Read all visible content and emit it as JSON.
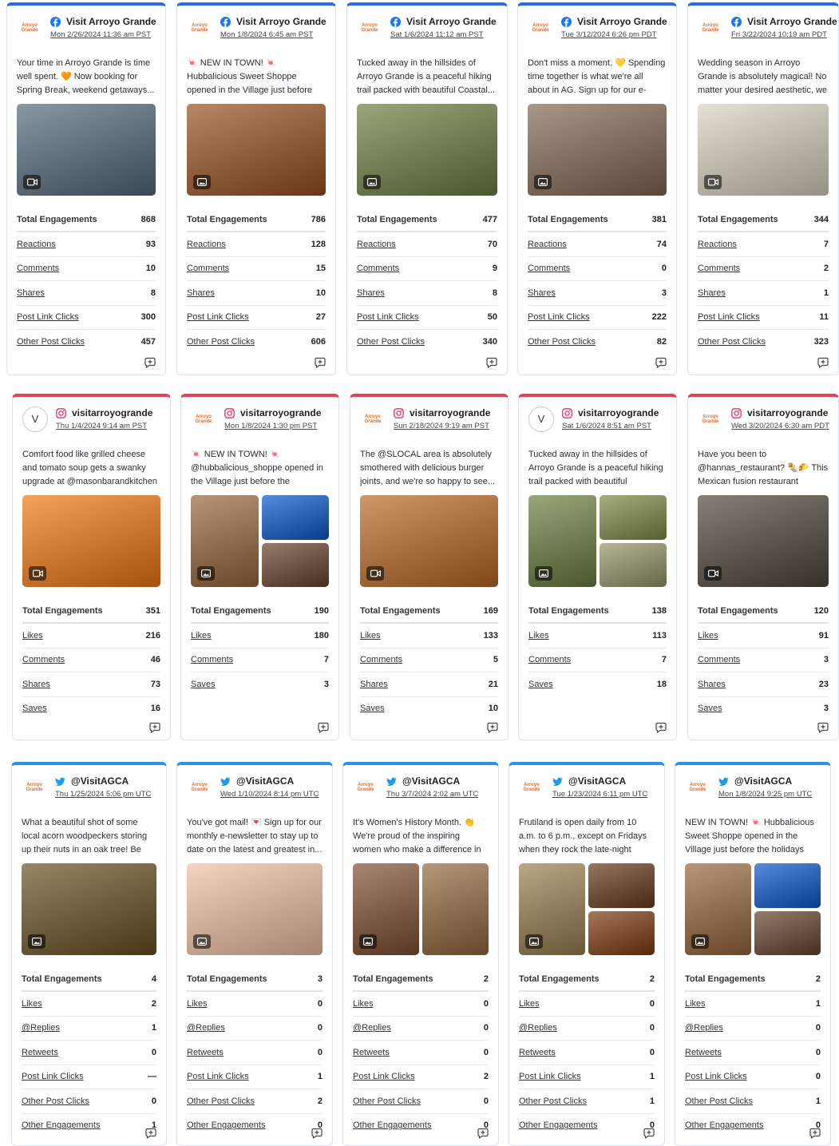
{
  "cards": [
    {
      "id": "c1",
      "network": "facebook",
      "account": "Visit Arroyo Grande",
      "avatar": "logo",
      "date": "Mon 2/26/2024 11:36 am PST",
      "text": "Your time in Arroyo Grande is time well spent. 🧡 Now booking for Spring Break, weekend getaways...",
      "media": "video",
      "layout": "single",
      "colors": [
        "#5c6b78"
      ],
      "metrics": [
        [
          "Total Engagements",
          "868"
        ],
        [
          "Reactions",
          "93"
        ],
        [
          "Comments",
          "10"
        ],
        [
          "Shares",
          "8"
        ],
        [
          "Post Link Clicks",
          "300"
        ],
        [
          "Other Post Clicks",
          "457"
        ]
      ]
    },
    {
      "id": "c2",
      "network": "facebook",
      "account": "Visit Arroyo Grande",
      "avatar": "logo",
      "date": "Mon 1/8/2024 6:45 am PST",
      "text": "🍬 NEW IN TOWN! 🍬 Hubbalicious Sweet Shoppe opened in the Village just before the holidays and has...",
      "media": "image",
      "layout": "single",
      "colors": [
        "#8a5a3a"
      ],
      "metrics": [
        [
          "Total Engagements",
          "786"
        ],
        [
          "Reactions",
          "128"
        ],
        [
          "Comments",
          "15"
        ],
        [
          "Shares",
          "10"
        ],
        [
          "Post Link Clicks",
          "27"
        ],
        [
          "Other Post Clicks",
          "606"
        ]
      ]
    },
    {
      "id": "c3",
      "network": "facebook",
      "account": "Visit Arroyo Grande",
      "avatar": "logo",
      "date": "Sat 1/6/2024 11:12 am PST",
      "text": "Tucked away in the hillsides of Arroyo Grande is a peaceful hiking trail packed with beautiful Coastal...",
      "media": "image",
      "layout": "single",
      "colors": [
        "#6d7a4f"
      ],
      "metrics": [
        [
          "Total Engagements",
          "477"
        ],
        [
          "Reactions",
          "70"
        ],
        [
          "Comments",
          "9"
        ],
        [
          "Shares",
          "8"
        ],
        [
          "Post Link Clicks",
          "50"
        ],
        [
          "Other Post Clicks",
          "340"
        ]
      ]
    },
    {
      "id": "c4",
      "network": "facebook",
      "account": "Visit Arroyo Grande",
      "avatar": "logo",
      "date": "Tue 3/12/2024 6:26 pm PDT",
      "text": "Don't miss a moment. 💛 Spending time together is what we're all about in AG. Sign up for our e-newsletter...",
      "media": "image",
      "layout": "single",
      "colors": [
        "#7c6a5c"
      ],
      "metrics": [
        [
          "Total Engagements",
          "381"
        ],
        [
          "Reactions",
          "74"
        ],
        [
          "Comments",
          "0"
        ],
        [
          "Shares",
          "3"
        ],
        [
          "Post Link Clicks",
          "222"
        ],
        [
          "Other Post Clicks",
          "82"
        ]
      ]
    },
    {
      "id": "c5",
      "network": "facebook",
      "account": "Visit Arroyo Grande",
      "avatar": "logo",
      "date": "Fri 3/22/2024 10:19 am PDT",
      "text": "Wedding season in Arroyo Grande is absolutely magical! No matter your desired aesthetic, we have the...",
      "media": "video",
      "layout": "single",
      "colors": [
        "#b9b3a8"
      ],
      "metrics": [
        [
          "Total Engagements",
          "344"
        ],
        [
          "Reactions",
          "7"
        ],
        [
          "Comments",
          "2"
        ],
        [
          "Shares",
          "1"
        ],
        [
          "Post Link Clicks",
          "11"
        ],
        [
          "Other Post Clicks",
          "323"
        ]
      ]
    },
    {
      "id": "c6",
      "network": "instagram",
      "account": "visitarroyogrande",
      "avatar": "V",
      "date": "Thu 1/4/2024 9:14 am PST",
      "text": "Comfort food like grilled cheese and tomato soup gets a swanky upgrade at @masonbarandkitchen in the...",
      "media": "video",
      "layout": "single",
      "colors": [
        "#c9752f"
      ],
      "metrics": [
        [
          "Total Engagements",
          "351"
        ],
        [
          "Likes",
          "216"
        ],
        [
          "Comments",
          "46"
        ],
        [
          "Shares",
          "73"
        ],
        [
          "Saves",
          "16"
        ]
      ]
    },
    {
      "id": "c7",
      "network": "instagram",
      "account": "visitarroyogrande",
      "avatar": "logo",
      "date": "Mon 1/8/2024 1:30 pm PST",
      "text": "🍬 NEW IN TOWN! 🍬 @hubbalicious_shoppe opened in the Village just before the holidays...",
      "media": "image",
      "layout": "three",
      "colors": [
        "#8a6a4a",
        "#2a5fb0",
        "#6a5040"
      ],
      "metrics": [
        [
          "Total Engagements",
          "190"
        ],
        [
          "Likes",
          "180"
        ],
        [
          "Comments",
          "7"
        ],
        [
          "Saves",
          "3"
        ]
      ]
    },
    {
      "id": "c8",
      "network": "instagram",
      "account": "visitarroyogrande",
      "avatar": "logo",
      "date": "Sun 2/18/2024 9:19 am PST",
      "text": "The @SLOCAL area is absolutely smothered with delicious burger joints, and we're so happy to see...",
      "media": "video",
      "layout": "single",
      "colors": [
        "#a36a3c"
      ],
      "metrics": [
        [
          "Total Engagements",
          "169"
        ],
        [
          "Likes",
          "133"
        ],
        [
          "Comments",
          "5"
        ],
        [
          "Shares",
          "21"
        ],
        [
          "Saves",
          "10"
        ]
      ]
    },
    {
      "id": "c9",
      "network": "instagram",
      "account": "visitarroyogrande",
      "avatar": "V",
      "date": "Sat 1/6/2024 8:51 am PST",
      "text": "Tucked away in the hillsides of Arroyo Grande is a peaceful hiking trail packed with beautiful Coastal...",
      "media": "image",
      "layout": "three",
      "colors": [
        "#6d7a4f",
        "#7a8252",
        "#8a8a6a"
      ],
      "metrics": [
        [
          "Total Engagements",
          "138"
        ],
        [
          "Likes",
          "113"
        ],
        [
          "Comments",
          "7"
        ],
        [
          "Saves",
          "18"
        ]
      ]
    },
    {
      "id": "c10",
      "network": "instagram",
      "account": "visitarroyogrande",
      "avatar": "logo",
      "date": "Wed 3/20/2024 6:30 am PDT",
      "text": "Have you been to @hannas_restaurant? 🌯🌮 This Mexican fusion restaurant recently...",
      "media": "video",
      "layout": "single",
      "colors": [
        "#5a534c"
      ],
      "metrics": [
        [
          "Total Engagements",
          "120"
        ],
        [
          "Likes",
          "91"
        ],
        [
          "Comments",
          "3"
        ],
        [
          "Shares",
          "23"
        ],
        [
          "Saves",
          "3"
        ]
      ]
    },
    {
      "id": "c11",
      "network": "twitter",
      "account": "@VisitAGCA",
      "avatar": "logo",
      "date": "Thu 1/25/2024 5:06 pm UTC",
      "text": "What a beautiful shot of some local acorn woodpeckers storing up their nuts in an oak tree! Be sure to tag ...",
      "media": "image",
      "layout": "single",
      "colors": [
        "#6a5a3a"
      ],
      "metrics": [
        [
          "Total Engagements",
          "4"
        ],
        [
          "Likes",
          "2"
        ],
        [
          "@Replies",
          "1"
        ],
        [
          "Retweets",
          "0"
        ],
        [
          "Post Link Clicks",
          "—"
        ],
        [
          "Other Post Clicks",
          "0"
        ],
        [
          "Other Engagements",
          "1"
        ]
      ]
    },
    {
      "id": "c12",
      "network": "twitter",
      "account": "@VisitAGCA",
      "avatar": "logo",
      "date": "Wed 1/10/2024 8:14 pm UTC",
      "text": "You've got mail! 💌 Sign up for our monthly e-newsletter to stay up to date on the latest and greatest in...",
      "media": "image",
      "layout": "single",
      "colors": [
        "#c8a894"
      ],
      "metrics": [
        [
          "Total Engagements",
          "3"
        ],
        [
          "Likes",
          "0"
        ],
        [
          "@Replies",
          "0"
        ],
        [
          "Retweets",
          "0"
        ],
        [
          "Post Link Clicks",
          "1"
        ],
        [
          "Other Post Clicks",
          "2"
        ],
        [
          "Other Engagements",
          "0"
        ]
      ]
    },
    {
      "id": "c13",
      "network": "twitter",
      "account": "@VisitAGCA",
      "avatar": "logo",
      "date": "Thu 3/7/2024 2:02 am UTC",
      "text": "It's Women's History Month. 👏 We're proud of the inspiring women who make a difference in AG. Meet...",
      "media": "image",
      "layout": "two",
      "colors": [
        "#7a5a44",
        "#8a6a4c"
      ],
      "metrics": [
        [
          "Total Engagements",
          "2"
        ],
        [
          "Likes",
          "0"
        ],
        [
          "@Replies",
          "0"
        ],
        [
          "Retweets",
          "0"
        ],
        [
          "Post Link Clicks",
          "2"
        ],
        [
          "Other Post Clicks",
          "0"
        ],
        [
          "Other Engagements",
          "0"
        ]
      ]
    },
    {
      "id": "c14",
      "network": "twitter",
      "account": "@VisitAGCA",
      "avatar": "logo",
      "date": "Tue 1/23/2024 6:11 pm UTC",
      "text": "Frutiland is open daily from 10 a.m. to 6 p.m., except on Fridays when they rock the late-night scene until...",
      "media": "image",
      "layout": "three",
      "colors": [
        "#8c7a5a",
        "#6a4a36",
        "#7a4a2c"
      ],
      "metrics": [
        [
          "Total Engagements",
          "2"
        ],
        [
          "Likes",
          "0"
        ],
        [
          "@Replies",
          "0"
        ],
        [
          "Retweets",
          "0"
        ],
        [
          "Post Link Clicks",
          "1"
        ],
        [
          "Other Post Clicks",
          "1"
        ],
        [
          "Other Engagements",
          "0"
        ]
      ]
    },
    {
      "id": "c15",
      "network": "twitter",
      "account": "@VisitAGCA",
      "avatar": "logo",
      "date": "Mon 1/8/2024 9:25 pm UTC",
      "text": "NEW IN TOWN! 🍬 Hubbalicious Sweet Shoppe opened in the Village just before the holidays and has...",
      "media": "image",
      "layout": "three",
      "colors": [
        "#8a6a4a",
        "#2a5fb0",
        "#6a5040"
      ],
      "metrics": [
        [
          "Total Engagements",
          "2"
        ],
        [
          "Likes",
          "1"
        ],
        [
          "@Replies",
          "0"
        ],
        [
          "Retweets",
          "0"
        ],
        [
          "Post Link Clicks",
          "0"
        ],
        [
          "Other Post Clicks",
          "1"
        ],
        [
          "Other Engagements",
          "0"
        ]
      ]
    }
  ]
}
